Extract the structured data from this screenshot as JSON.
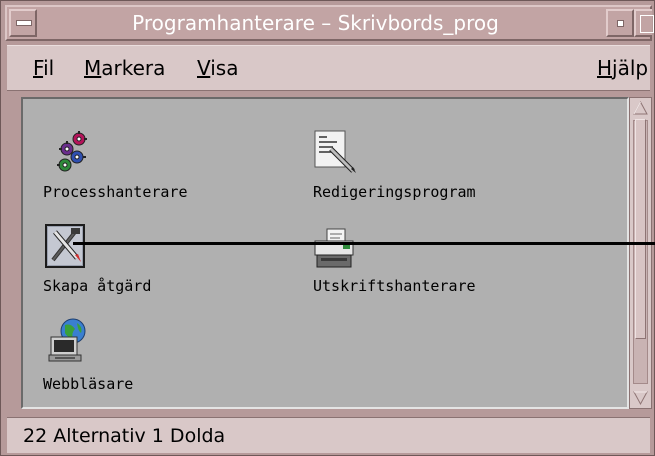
{
  "window": {
    "title": "Programhanterare – Skrivbords_prog"
  },
  "menubar": {
    "items": [
      {
        "label": "Fil",
        "mnemonic": "F"
      },
      {
        "label": "Markera",
        "mnemonic": "M"
      },
      {
        "label": "Visa",
        "mnemonic": "V"
      },
      {
        "label": "Hjälp",
        "mnemonic": "H"
      }
    ]
  },
  "icons": [
    {
      "label": "Processhanterare",
      "icon": "gears-icon"
    },
    {
      "label": "Redigeringsprogram",
      "icon": "notepad-pencil-icon"
    },
    {
      "label": "Skapa åtgärd",
      "icon": "create-action-icon"
    },
    {
      "label": "Utskriftshanterare",
      "icon": "printer-icon"
    },
    {
      "label": "Webbläsare",
      "icon": "globe-computer-icon"
    }
  ],
  "status": {
    "text": "22 Alternativ 1 Dolda"
  },
  "colors": {
    "frame": "#b69a9a",
    "menubar": "#d9c8c8",
    "pane": "#b0b0b0"
  }
}
